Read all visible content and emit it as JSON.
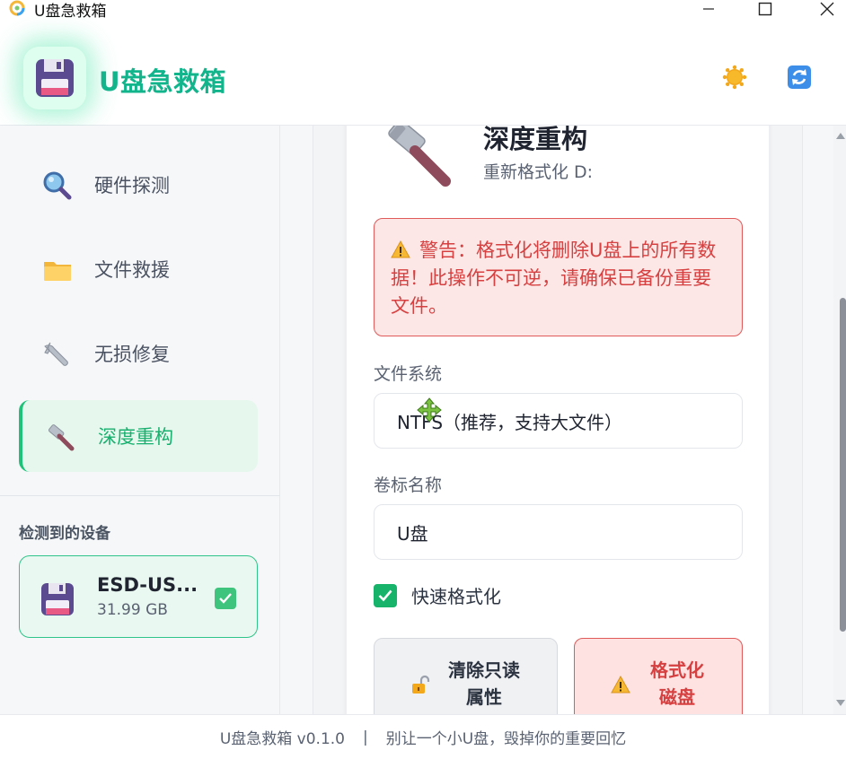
{
  "window": {
    "title": "U盘急救箱",
    "min_icon": "minimize-icon",
    "max_icon": "maximize-icon",
    "close_icon": "close-icon"
  },
  "header": {
    "app_name": "U盘急救箱",
    "theme_icon": "sun-icon",
    "refresh_icon": "refresh-icon"
  },
  "sidebar": {
    "items": [
      {
        "label": "硬件探测",
        "icon": "magnifier-icon"
      },
      {
        "label": "文件救援",
        "icon": "folder-icon"
      },
      {
        "label": "无损修复",
        "icon": "wrench-icon"
      },
      {
        "label": "深度重构",
        "icon": "hammer-icon",
        "active": true
      }
    ],
    "devices_heading": "检测到的设备",
    "device": {
      "name": "ESD-US...",
      "size": "31.99 GB",
      "checked": true
    }
  },
  "main": {
    "title": "深度重构",
    "subtitle": "重新格式化 D:",
    "warning": "警告：格式化将删除U盘上的所有数据！此操作不可逆，请确保已备份重要文件。",
    "fs_label": "文件系统",
    "fs_value": "NTFS（推荐，支持大文件）",
    "volume_label": "卷标名称",
    "volume_value": "U盘",
    "quick_format_label": "快速格式化",
    "quick_format_checked": true,
    "clear_readonly_label_1": "清除只读",
    "clear_readonly_label_2": "属性",
    "format_label_1": "格式化",
    "format_label_2": "磁盘"
  },
  "footer": {
    "version": "U盘急救箱 v0.1.0",
    "separator": "|",
    "slogan": "别让一个小U盘，毁掉你的重要回忆"
  },
  "colors": {
    "accent": "#12b48c",
    "active_nav_bg": "#e6f7ee",
    "danger": "#d64040",
    "danger_bg": "#fde7e6"
  }
}
